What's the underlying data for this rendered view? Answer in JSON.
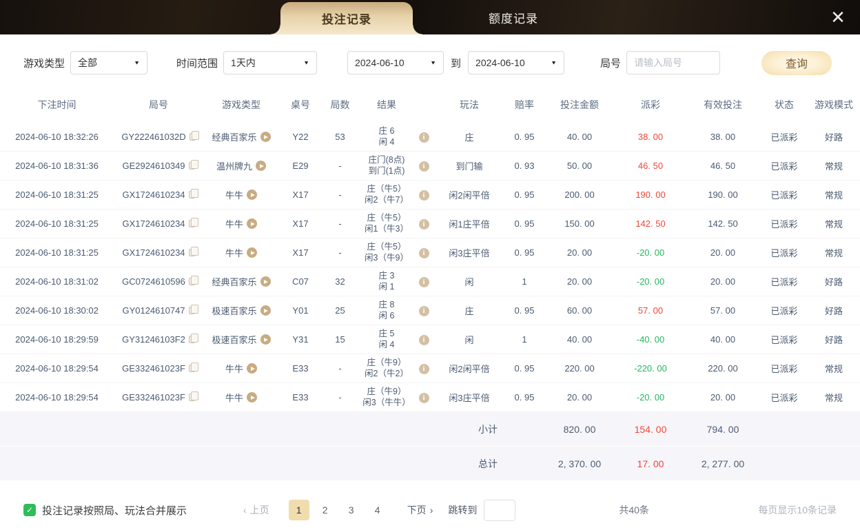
{
  "icons": {
    "close": "✕",
    "dropdown": "▼",
    "prev": "‹",
    "next": "›",
    "check": "✓",
    "info": "info-circle",
    "play": "play-circle",
    "copy": "copy-sheets"
  },
  "tabs": {
    "bet_records": "投注记录",
    "quota_records": "额度记录"
  },
  "filters": {
    "game_type_label": "游戏类型",
    "game_type_value": "全部",
    "time_range_label": "时间范围",
    "time_range_value": "1天内",
    "date_from": "2024-06-10",
    "to_label": "到",
    "date_to": "2024-06-10",
    "round_label": "局号",
    "round_placeholder": "请输入局号",
    "search_button": "查询"
  },
  "table": {
    "headers": [
      "下注时间",
      "局号",
      "游戏类型",
      "桌号",
      "局数",
      "结果",
      "",
      "玩法",
      "赔率",
      "投注金额",
      "派彩",
      "有效投注",
      "状态",
      "游戏模式"
    ],
    "rows": [
      {
        "time": "2024-06-10 18:32:26",
        "round_id": "GY222461032D",
        "game": "经典百家乐",
        "table_no": "Y22",
        "rounds": "53",
        "result1": "庄 6",
        "result2": "闲 4",
        "play": "庄",
        "odds": "0. 95",
        "bet": "40. 00",
        "payout": "38. 00",
        "payout_color": "red",
        "valid": "38. 00",
        "status": "已派彩",
        "mode": "好路"
      },
      {
        "time": "2024-06-10 18:31:36",
        "round_id": "GE2924610349",
        "game": "温州牌九",
        "table_no": "E29",
        "rounds": "-",
        "result1": "庄门(8点)",
        "result2": "到门(1点)",
        "play": "到门输",
        "odds": "0. 93",
        "bet": "50. 00",
        "payout": "46. 50",
        "payout_color": "red",
        "valid": "46. 50",
        "status": "已派彩",
        "mode": "常规"
      },
      {
        "time": "2024-06-10 18:31:25",
        "round_id": "GX1724610234",
        "game": "牛牛",
        "table_no": "X17",
        "rounds": "-",
        "result1": "庄（牛5）",
        "result2": "闲2（牛7）",
        "play": "闲2闲平倍",
        "odds": "0. 95",
        "bet": "200. 00",
        "payout": "190. 00",
        "payout_color": "red",
        "valid": "190. 00",
        "status": "已派彩",
        "mode": "常规"
      },
      {
        "time": "2024-06-10 18:31:25",
        "round_id": "GX1724610234",
        "game": "牛牛",
        "table_no": "X17",
        "rounds": "-",
        "result1": "庄（牛5）",
        "result2": "闲1（牛3）",
        "play": "闲1庄平倍",
        "odds": "0. 95",
        "bet": "150. 00",
        "payout": "142. 50",
        "payout_color": "red",
        "valid": "142. 50",
        "status": "已派彩",
        "mode": "常规"
      },
      {
        "time": "2024-06-10 18:31:25",
        "round_id": "GX1724610234",
        "game": "牛牛",
        "table_no": "X17",
        "rounds": "-",
        "result1": "庄（牛5）",
        "result2": "闲3（牛9）",
        "play": "闲3庄平倍",
        "odds": "0. 95",
        "bet": "20. 00",
        "payout": "-20. 00",
        "payout_color": "green",
        "valid": "20. 00",
        "status": "已派彩",
        "mode": "常规"
      },
      {
        "time": "2024-06-10 18:31:02",
        "round_id": "GC0724610596",
        "game": "经典百家乐",
        "table_no": "C07",
        "rounds": "32",
        "result1": "庄 3",
        "result2": "闲 1",
        "play": "闲",
        "odds": "1",
        "bet": "20. 00",
        "payout": "-20. 00",
        "payout_color": "green",
        "valid": "20. 00",
        "status": "已派彩",
        "mode": "好路"
      },
      {
        "time": "2024-06-10 18:30:02",
        "round_id": "GY0124610747",
        "game": "极速百家乐",
        "table_no": "Y01",
        "rounds": "25",
        "result1": "庄 8",
        "result2": "闲 6",
        "play": "庄",
        "odds": "0. 95",
        "bet": "60. 00",
        "payout": "57. 00",
        "payout_color": "red",
        "valid": "57. 00",
        "status": "已派彩",
        "mode": "好路"
      },
      {
        "time": "2024-06-10 18:29:59",
        "round_id": "GY31246103F2",
        "game": "极速百家乐",
        "table_no": "Y31",
        "rounds": "15",
        "result1": "庄 5",
        "result2": "闲 4",
        "play": "闲",
        "odds": "1",
        "bet": "40. 00",
        "payout": "-40. 00",
        "payout_color": "green",
        "valid": "40. 00",
        "status": "已派彩",
        "mode": "好路"
      },
      {
        "time": "2024-06-10 18:29:54",
        "round_id": "GE332461023F",
        "game": "牛牛",
        "table_no": "E33",
        "rounds": "-",
        "result1": "庄（牛9）",
        "result2": "闲2（牛2）",
        "play": "闲2闲平倍",
        "odds": "0. 95",
        "bet": "220. 00",
        "payout": "-220. 00",
        "payout_color": "green",
        "valid": "220. 00",
        "status": "已派彩",
        "mode": "常规"
      },
      {
        "time": "2024-06-10 18:29:54",
        "round_id": "GE332461023F",
        "game": "牛牛",
        "table_no": "E33",
        "rounds": "-",
        "result1": "庄（牛9）",
        "result2": "闲3（牛牛）",
        "play": "闲3庄平倍",
        "odds": "0. 95",
        "bet": "20. 00",
        "payout": "-20. 00",
        "payout_color": "green",
        "valid": "20. 00",
        "status": "已派彩",
        "mode": "常规"
      }
    ],
    "subtotal": {
      "label": "小计",
      "bet": "820. 00",
      "payout": "154. 00",
      "valid": "794. 00"
    },
    "total": {
      "label": "总计",
      "bet": "2, 370. 00",
      "payout": "17. 00",
      "valid": "2, 277. 00"
    }
  },
  "footer": {
    "merge_label": "投注记录按照局、玩法合并展示",
    "prev_label": "上页",
    "next_label": "下页",
    "pages": [
      "1",
      "2",
      "3",
      "4"
    ],
    "active_page": "1",
    "jump_label": "跳转到",
    "total_count": "共40条",
    "page_size": "每页显示10条记录"
  },
  "colors": {
    "accent_gold": "#e9d3a6",
    "tab_gradient_top": "#c9ab7f",
    "tab_gradient_bottom": "#f4e7ca",
    "win_red": "#f04537",
    "loss_green": "#22b85c",
    "checkbox_green": "#2ebd59",
    "summary_bg": "#f6f6fa",
    "topbar_dark": "#1b140e"
  }
}
